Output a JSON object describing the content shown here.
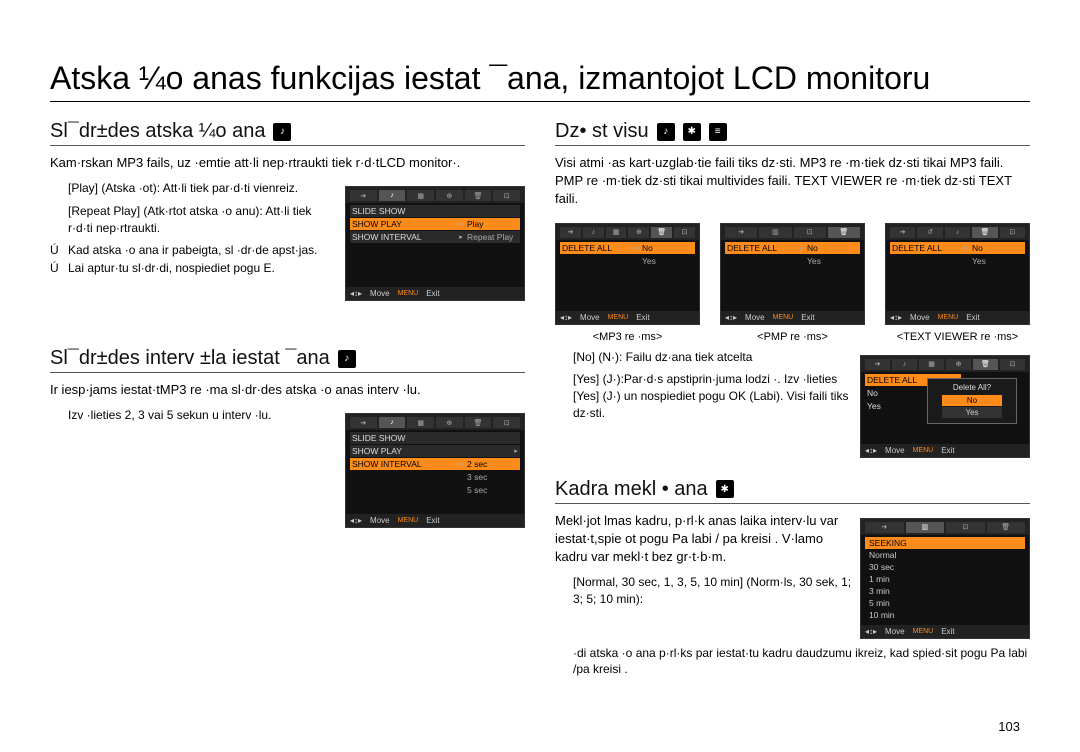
{
  "title": "Atska ¼o anas funkcijas iestat ¯ana, izmantojot LCD monitoru",
  "pagenum": "103",
  "left": {
    "sec1": {
      "title": "Sl¯dr±des atska ¼o ana",
      "body": "Kam·rskan MP3 fails, uz ·emtie att·li nep·rtraukti tiek r·d·tLCD monitor·.",
      "opt1": "[Play] (Atska ·ot): Att·li tiek par·d·ti vienreiz.",
      "opt2": "[Repeat Play] (Atk·rtot atska ·o anu): Att·li tiek r·d·ti nep·rtraukti.",
      "b1": "Kad atska ·o ana ir pabeigta, sl ·dr·de apst·jas.",
      "b2": "Lai aptur·tu sl·dr·di, nospiediet pogu E."
    },
    "sec2": {
      "title": "Sl¯dr±des interv ±la iestat ¯ana",
      "body": "Ir iesp·jams iestat·tMP3 re ·ma sl·dr·des atska ·o anas interv ·lu.",
      "opt": "Izv ·lieties 2, 3 vai 5 sekun u interv ·lu."
    }
  },
  "right": {
    "sec1": {
      "title": "Dz• st visu",
      "body": "Visi atmi ·as kart·uzglab·tie faili tiks dz·sti. MP3 re ·m·tiek dz·sti tikai MP3 faili. PMP re ·m·tiek dz·sti tikai multivides faili. TEXT VIEWER re ·m·tiek dz·sti TEXT faili.",
      "cap1": "<MP3 re ·ms>",
      "cap2": "<PMP re ·ms>",
      "cap3": "<TEXT VIEWER re ·ms>",
      "no": "[No] (N·): Failu dz·ana tiek atcelta",
      "yes": "[Yes] (J·):Par·d·s apstiprin·juma lodzi ·. Izv ·lieties [Yes] (J·) un nospiediet pogu OK (Labi). Visi faili tiks dz·sti."
    },
    "sec2": {
      "title": "Kadra mekl • ana",
      "body": "Mekl·jot lmas kadru, p·rl·k anas laika interv·lu var iestat·t,spie ot pogu  Pa labi / pa kreisi . V·lamo kadru var mekl·t bez gr·t·b·m.",
      "opt": "[Normal, 30 sec, 1, 3, 5, 10 min] (Norm·ls, 30 sek, 1; 3; 5; 10 min):",
      "opt2": "·di atska ·o ana p·rl·ks par iestat·tu kadru daudzumu ikreiz, kad spied·sit pogu Pa labi /pa kreisi ."
    }
  },
  "lcd": {
    "slideShow": "SLIDE SHOW",
    "showPlay": "SHOW PLAY",
    "showInterval": "SHOW INTERVAL",
    "play": "Play",
    "repeat": "Repeat Play",
    "s2": "2 sec",
    "s3": "3 sec",
    "s5": "5 sec",
    "move": "Move",
    "menu": "MENU",
    "exit": "Exit",
    "deleteAll": "DELETE ALL",
    "no": "No",
    "yes": "Yes",
    "deleteAllQ": "Delete All?",
    "seeking": "SEEKING",
    "normal": "Normal",
    "t30": "30 sec",
    "t1": "1 min",
    "t3": "3 min",
    "t5": "5 min",
    "t10": "10 min"
  }
}
